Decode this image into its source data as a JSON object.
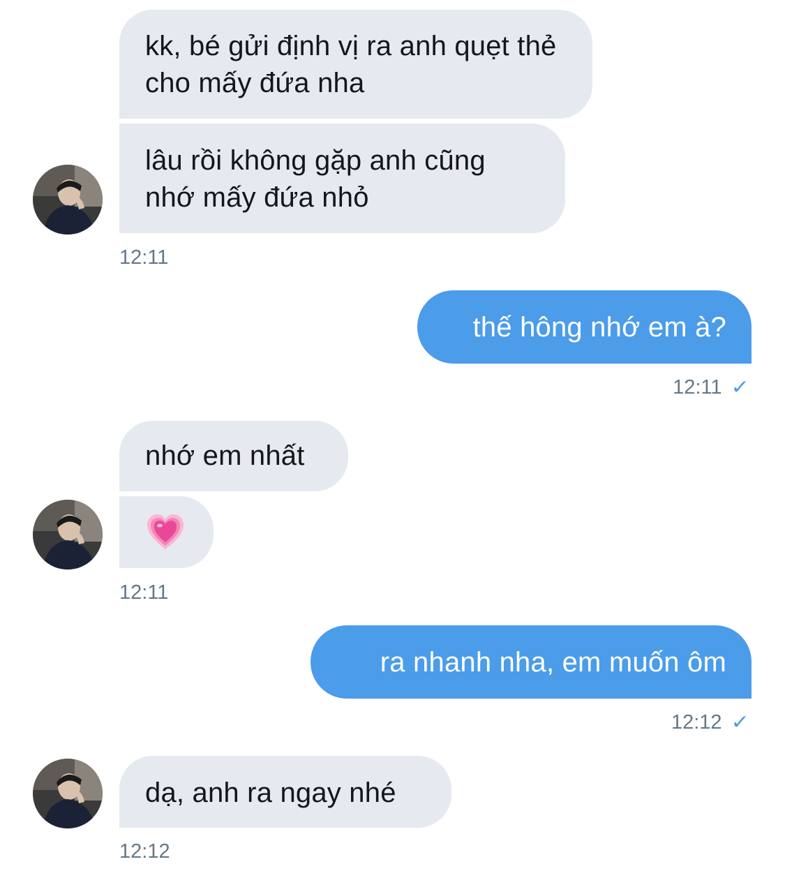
{
  "colors": {
    "received_bubble": "#e6e9ef",
    "sent_bubble": "#4b9ce9",
    "timestamp": "#657786",
    "read_check": "#4b9ce9"
  },
  "messages": {
    "m1": "kk, bé gửi định vị ra anh quẹt thẻ cho mấy đứa nha",
    "m2": "lâu rồi không gặp anh cũng nhớ mấy đứa nhỏ",
    "m3": "thế hông nhớ em à?",
    "m4": "nhớ em nhất",
    "m5_icon": "growing-heart-emoji",
    "m6": "ra nhanh nha, em muốn ôm",
    "m7": "dạ, anh ra ngay nhé"
  },
  "timestamps": {
    "t1": "12:11",
    "t2": "12:11",
    "t3": "12:11",
    "t4": "12:12",
    "t5": "12:12"
  },
  "icons": {
    "read_receipt": "✓",
    "avatar": "contact-avatar-photo"
  }
}
